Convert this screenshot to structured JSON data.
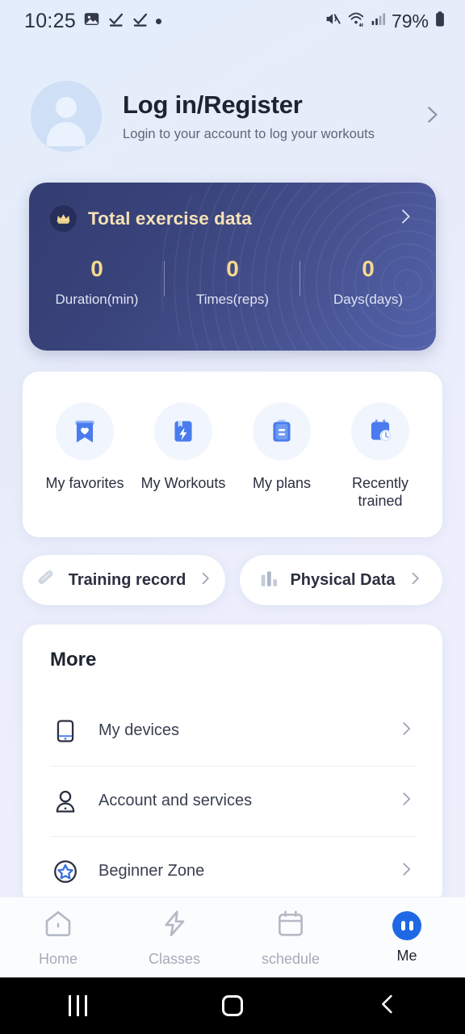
{
  "status_bar": {
    "time": "10:25",
    "battery_percent": "79%",
    "left_icons": [
      "image-icon",
      "task-check-icon",
      "task-check-icon",
      "dot-icon"
    ],
    "right_icons": [
      "volume-mute-icon",
      "wifi-6-icon",
      "cellular-signal-icon",
      "battery-icon"
    ]
  },
  "account": {
    "title": "Log in/Register",
    "subtitle": "Login to your account to log your workouts",
    "avatar_icon": "user-placeholder-icon",
    "chevron_icon": "chevron-right-icon"
  },
  "total_exercise": {
    "badge_icon": "crown-icon",
    "title": "Total exercise data",
    "chevron_icon": "chevron-right-icon",
    "stats": [
      {
        "value": "0",
        "label": "Duration(min)"
      },
      {
        "value": "0",
        "label": "Times(reps)"
      },
      {
        "value": "0",
        "label": "Days(days)"
      }
    ],
    "gradient_from": "#333d71",
    "gradient_to": "#5362aa",
    "accent_color": "#f5d98f"
  },
  "quick_actions": [
    {
      "label": "My favorites",
      "icon": "bookmark-heart-icon"
    },
    {
      "label": "My Workouts",
      "icon": "book-lightning-icon"
    },
    {
      "label": "My plans",
      "icon": "clipboard-icon"
    },
    {
      "label": "Recently trained",
      "icon": "calendar-clock-icon"
    }
  ],
  "shortcut_pills": [
    {
      "label": "Training record",
      "icon": "dumbbell-icon",
      "chevron_icon": "chevron-right-icon"
    },
    {
      "label": "Physical Data",
      "icon": "bar-chart-icon",
      "chevron_icon": "chevron-right-icon"
    }
  ],
  "more": {
    "title": "More",
    "items": [
      {
        "label": "My devices",
        "icon": "device-icon",
        "chevron_icon": "chevron-right-icon"
      },
      {
        "label": "Account and services",
        "icon": "person-icon",
        "chevron_icon": "chevron-right-icon"
      },
      {
        "label": "Beginner Zone",
        "icon": "star-circle-icon",
        "chevron_icon": "chevron-right-icon"
      }
    ]
  },
  "bottom_nav": {
    "active": "Me",
    "accent_color": "#1f68e5",
    "items": [
      {
        "label": "Home",
        "icon": "home-icon"
      },
      {
        "label": "Classes",
        "icon": "lightning-icon"
      },
      {
        "label": "schedule",
        "icon": "calendar-icon"
      },
      {
        "label": "Me",
        "icon": "me-avatar-icon"
      }
    ]
  },
  "android_nav": {
    "recents_icon": "recents-icon",
    "home_icon": "home-square-icon",
    "back_icon": "back-chevron-icon"
  }
}
